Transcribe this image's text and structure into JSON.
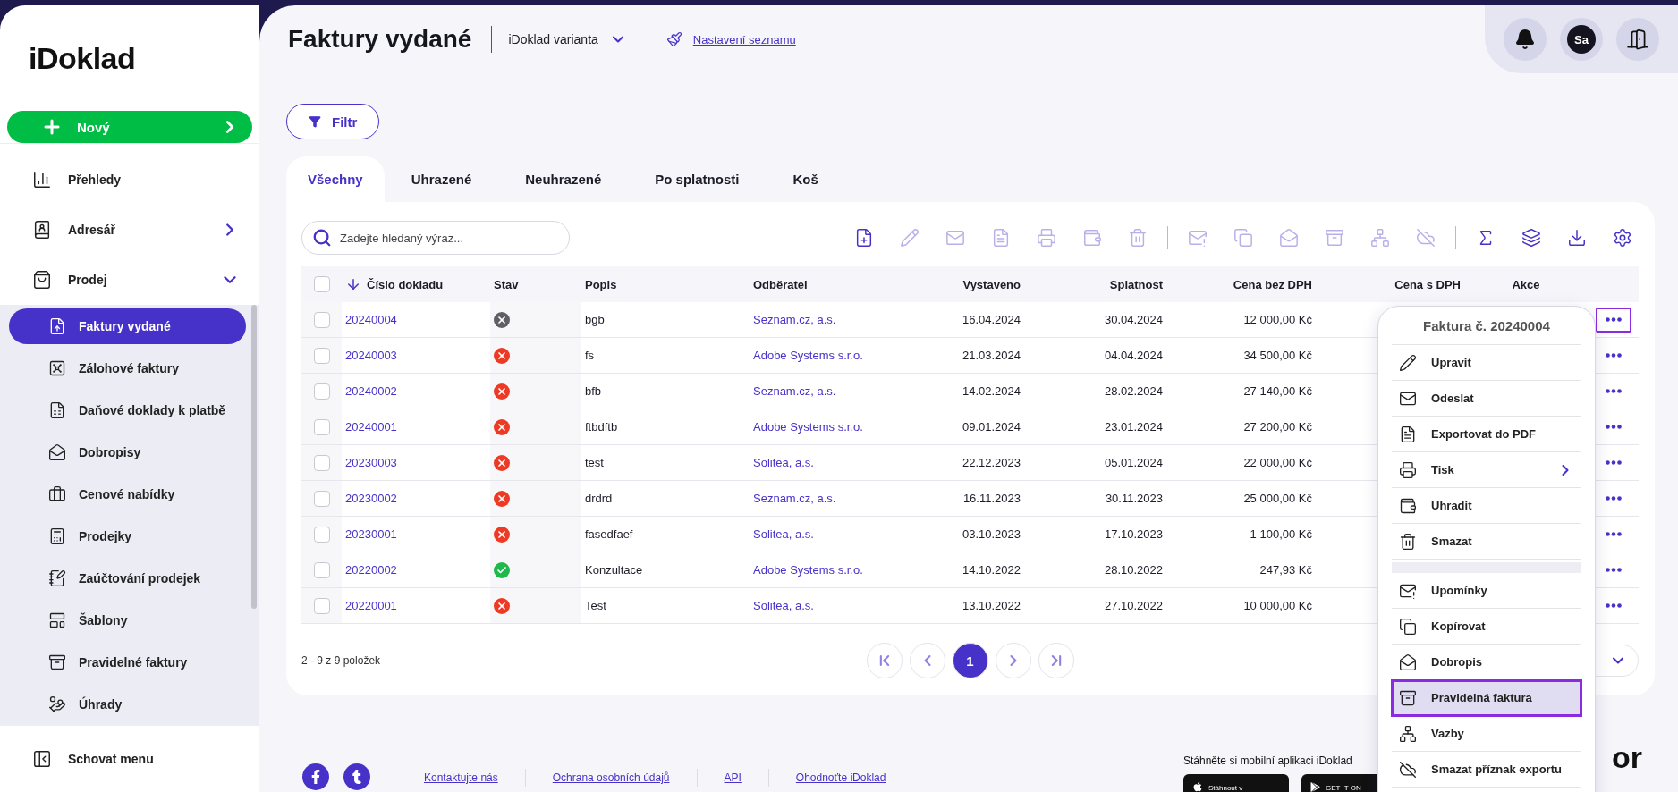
{
  "logo": {
    "text": "iDoklad"
  },
  "new_button": {
    "label": "Nový"
  },
  "sidebar": {
    "items": [
      {
        "label": "Přehledy",
        "kind": "link"
      },
      {
        "label": "Adresář",
        "kind": "submenu",
        "expanded": false
      },
      {
        "label": "Prodej",
        "kind": "submenu",
        "expanded": true,
        "children": [
          {
            "label": "Faktury vydané",
            "selected": true
          },
          {
            "label": "Zálohové faktury",
            "selected": false
          },
          {
            "label": "Daňové doklady k platbě",
            "selected": false
          },
          {
            "label": "Dobropisy",
            "selected": false
          },
          {
            "label": "Cenové nabídky",
            "selected": false
          },
          {
            "label": "Prodejky",
            "selected": false
          },
          {
            "label": "Zaúčtování prodejek",
            "selected": false
          },
          {
            "label": "Šablony",
            "selected": false
          },
          {
            "label": "Pravidelné faktury",
            "selected": false
          },
          {
            "label": "Úhrady",
            "selected": false
          }
        ]
      }
    ],
    "hide_menu": "Schovat menu"
  },
  "header": {
    "title": "Faktury vydané",
    "variant": "iDoklad varianta",
    "settings_link": "Nastavení seznamu"
  },
  "user": {
    "initials": "Sa"
  },
  "filter_button": "Filtr",
  "tabs": [
    {
      "label": "Všechny",
      "selected": true
    },
    {
      "label": "Uhrazené",
      "selected": false
    },
    {
      "label": "Neuhrazené",
      "selected": false
    },
    {
      "label": "Po splatnosti",
      "selected": false
    },
    {
      "label": "Koš",
      "selected": false
    }
  ],
  "search": {
    "placeholder": "Zadejte hledaný výraz..."
  },
  "toolbar": [
    [
      {
        "disabled": false
      },
      {
        "disabled": true
      },
      {
        "disabled": true
      },
      {
        "disabled": true
      },
      {
        "disabled": true
      },
      {
        "disabled": true
      },
      {
        "disabled": true
      }
    ],
    [
      {
        "disabled": true
      },
      {
        "disabled": true
      },
      {
        "disabled": true
      },
      {
        "disabled": true
      },
      {
        "disabled": true
      },
      {
        "disabled": true
      }
    ],
    [
      {
        "disabled": false
      },
      {
        "disabled": false
      },
      {
        "disabled": false
      },
      {
        "disabled": false
      }
    ]
  ],
  "table": {
    "all_checked": false,
    "columns": [
      {
        "label": "Číslo dokladu",
        "sorted": true
      },
      {
        "label": "Stav",
        "sorted": false
      },
      {
        "label": "Popis",
        "sorted": false
      },
      {
        "label": "Odběratel",
        "sorted": false
      },
      {
        "label": "Vystaveno",
        "sorted": false
      },
      {
        "label": "Splatnost",
        "sorted": false
      },
      {
        "label": "Cena bez DPH",
        "sorted": false
      },
      {
        "label": "Cena s DPH",
        "sorted": false
      },
      {
        "label": "Akce",
        "sorted": false
      }
    ],
    "rows": [
      {
        "checked": false,
        "number": "20240004",
        "kind": "cancelled",
        "description": "bgb",
        "customer": "Seznam.cz, a.s.",
        "issued": "16.04.2024",
        "due": "30.04.2024",
        "price_net": "12 000,00 Kč",
        "menu_open": true
      },
      {
        "checked": false,
        "number": "20240003",
        "kind": "unpaid",
        "description": "fs",
        "customer": "Adobe Systems s.r.o.",
        "issued": "21.03.2024",
        "due": "04.04.2024",
        "price_net": "34 500,00 Kč",
        "menu_open": false
      },
      {
        "checked": false,
        "number": "20240002",
        "kind": "unpaid",
        "description": "bfb",
        "customer": "Seznam.cz, a.s.",
        "issued": "14.02.2024",
        "due": "28.02.2024",
        "price_net": "27 140,00 Kč",
        "menu_open": false
      },
      {
        "checked": false,
        "number": "20240001",
        "kind": "unpaid",
        "description": "ftbdftb",
        "customer": "Adobe Systems s.r.o.",
        "issued": "09.01.2024",
        "due": "23.01.2024",
        "price_net": "27 200,00 Kč",
        "menu_open": false
      },
      {
        "checked": false,
        "number": "20230003",
        "kind": "unpaid",
        "description": "test",
        "customer": "Solitea, a.s.",
        "issued": "22.12.2023",
        "due": "05.01.2024",
        "price_net": "22 000,00 Kč",
        "menu_open": false
      },
      {
        "checked": false,
        "number": "20230002",
        "kind": "unpaid",
        "description": "drdrd",
        "customer": "Seznam.cz, a.s.",
        "issued": "16.11.2023",
        "due": "30.11.2023",
        "price_net": "25 000,00 Kč",
        "menu_open": false
      },
      {
        "checked": false,
        "number": "20230001",
        "kind": "unpaid",
        "description": "fasedfaef",
        "customer": "Solitea, a.s.",
        "issued": "03.10.2023",
        "due": "17.10.2023",
        "price_net": "1 100,00 Kč",
        "menu_open": false
      },
      {
        "checked": false,
        "number": "20220002",
        "kind": "paid",
        "description": "Konzultace",
        "customer": "Adobe Systems s.r.o.",
        "issued": "14.10.2022",
        "due": "28.10.2022",
        "price_net": "247,93 Kč",
        "menu_open": false
      },
      {
        "checked": false,
        "number": "20220001",
        "kind": "unpaid",
        "description": "Test",
        "customer": "Solitea, a.s.",
        "issued": "13.10.2022",
        "due": "27.10.2022",
        "price_net": "10 000,00 Kč",
        "menu_open": false
      }
    ]
  },
  "pagination": {
    "summary": "2 - 9 z 9 položek",
    "pages": [
      {
        "label": "1",
        "selected": true
      }
    ]
  },
  "context_menu": {
    "title": "Faktura č. 20240004",
    "sections": [
      [
        {
          "label": "Upravit",
          "selected": false,
          "has_submenu": false
        },
        {
          "label": "Odeslat",
          "selected": false,
          "has_submenu": false
        },
        {
          "label": "Exportovat do PDF",
          "selected": false,
          "has_submenu": false
        },
        {
          "label": "Tisk",
          "selected": false,
          "has_submenu": true
        },
        {
          "label": "Uhradit",
          "selected": false,
          "has_submenu": false
        },
        {
          "label": "Smazat",
          "selected": false,
          "has_submenu": false
        }
      ],
      [
        {
          "label": "Upomínky",
          "selected": false,
          "has_submenu": false
        },
        {
          "label": "Kopírovat",
          "selected": false,
          "has_submenu": false
        },
        {
          "label": "Dobropis",
          "selected": false,
          "has_submenu": false
        },
        {
          "label": "Pravidelná faktura",
          "selected": true,
          "has_submenu": false
        },
        {
          "label": "Vazby",
          "selected": false,
          "has_submenu": false
        },
        {
          "label": "Smazat příznak exportu",
          "selected": false,
          "has_submenu": false
        }
      ]
    ]
  },
  "footer": {
    "links": [
      "Kontaktujte nás",
      "Ochrana osobních údajů",
      "API",
      "Ohodnoťte iDoklad"
    ],
    "app_text": "Stáhněte si mobilní aplikaci iDoklad",
    "badges": [
      "Stáhnout v",
      "GET IT ON"
    ],
    "fragment": "or"
  }
}
